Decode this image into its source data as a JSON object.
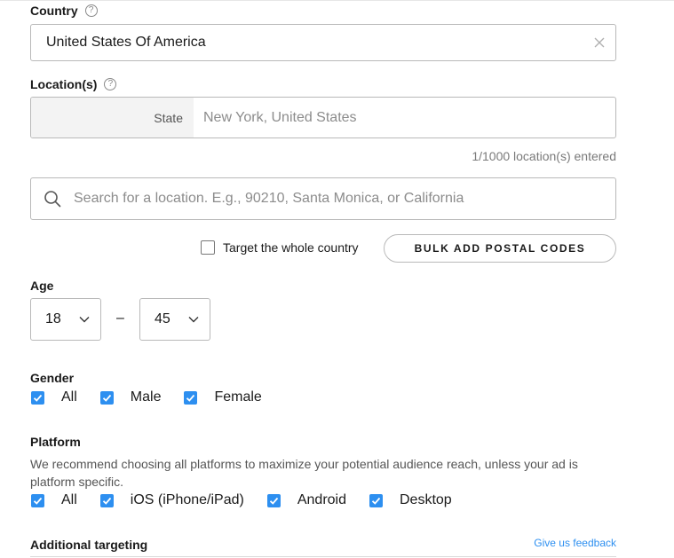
{
  "country": {
    "label": "Country",
    "help": "?",
    "value": "United States Of America"
  },
  "locations": {
    "label": "Location(s)",
    "help": "?",
    "type": "State",
    "value": "New York, United States",
    "count_text": "1/1000 location(s) entered"
  },
  "search": {
    "placeholder": "Search for a location. E.g., 90210, Santa Monica, or California"
  },
  "target_whole_country": {
    "label": "Target the whole country",
    "checked": false
  },
  "bulk_add": {
    "label": "BULK ADD POSTAL CODES"
  },
  "age": {
    "label": "Age",
    "min": "18",
    "separator": "–",
    "max": "45"
  },
  "gender": {
    "label": "Gender",
    "options": [
      {
        "label": "All",
        "checked": true
      },
      {
        "label": "Male",
        "checked": true
      },
      {
        "label": "Female",
        "checked": true
      }
    ]
  },
  "platform": {
    "label": "Platform",
    "description": "We recommend choosing all platforms to maximize your potential audience reach, unless your ad is platform specific.",
    "options": [
      {
        "label": "All",
        "checked": true
      },
      {
        "label": "iOS (iPhone/iPad)",
        "checked": true
      },
      {
        "label": "Android",
        "checked": true
      },
      {
        "label": "Desktop",
        "checked": true
      }
    ]
  },
  "additional_targeting": {
    "label": "Additional targeting",
    "feedback_link": "Give us feedback"
  },
  "colors": {
    "accent": "#2d8ff0",
    "border": "#b9b9b9",
    "muted_text": "#8c8c8c"
  }
}
